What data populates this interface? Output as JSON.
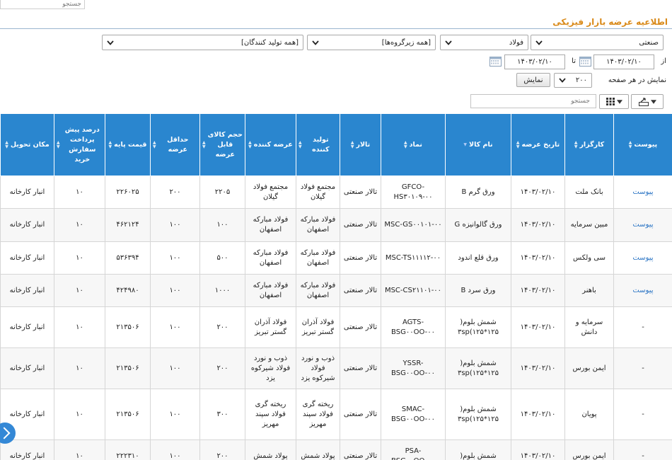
{
  "top_search": {
    "placeholder": "جستجو"
  },
  "page_title": "اطلاعیه عرضه بازار فیزیکی",
  "filters": {
    "hall": "صنعتی",
    "group": "فولاد",
    "subgroup": "[همه زیرگروه‌ها]",
    "producers": "[همه تولید کنندگان]"
  },
  "date_range": {
    "from_label": "از",
    "from_value": "۱۴۰۳/۰۲/۱۰",
    "to_label": "تا",
    "to_value": "۱۴۰۳/۰۲/۱۰"
  },
  "paging": {
    "per_page_label": "نمایش در هر صفحه",
    "per_page_value": "۲۰۰",
    "show_button": "نمایش"
  },
  "grid_search": {
    "placeholder": "جستجو"
  },
  "table": {
    "columns": [
      "پیوست",
      "کارگزار",
      "تاریخ عرضه",
      "نام کالا",
      "نماد",
      "تالار",
      "تولید کننده",
      "عرضه کننده",
      "حجم کالای قابل عرضه",
      "حداقل عرضه",
      "قیمت پایه",
      "درصد پیش پرداخت سفارش خرید",
      "مکان تحویل"
    ],
    "rows": [
      [
        "پیوست",
        "بانک ملت",
        "۱۴۰۳/۰۲/۱۰",
        "ورق گرم B",
        "GFCO-HS۳۰۱۰۹-۰۰",
        "تالار صنعتی",
        "مجتمع فولاد گیلان",
        "مجتمع فولاد گیلان",
        "۲۲۰۵",
        "۲۰۰",
        "۲۲۶۰۲۵",
        "۱۰",
        "انبار کارخانه"
      ],
      [
        "پیوست",
        "مبین سرمایه",
        "۱۴۰۳/۰۲/۱۰",
        "ورق گالوانیزه G",
        "MSC-GS۰۰۱۰۱-۰۰",
        "تالار صنعتی",
        "فولاد مبارکه اصفهان",
        "فولاد مبارکه اصفهان",
        "۱۰۰",
        "۱۰۰",
        "۴۶۲۱۲۴",
        "۱۰",
        "انبار کارخانه"
      ],
      [
        "پیوست",
        "سی ولکس",
        "۱۴۰۳/۰۲/۱۰",
        "ورق قلع اندود",
        "MSC-TS۱۱۱۱۲-۰۰",
        "تالار صنعتی",
        "فولاد مبارکه اصفهان",
        "فولاد مبارکه اصفهان",
        "۵۰۰",
        "۱۰۰",
        "۵۳۶۳۹۴",
        "۱۰",
        "انبار کارخانه"
      ],
      [
        "پیوست",
        "باهنر",
        "۱۴۰۳/۰۲/۱۰",
        "ورق سرد B",
        "MSC-CS۲۱۱۰۱-۰۰",
        "تالار صنعتی",
        "فولاد مبارکه اصفهان",
        "فولاد مبارکه اصفهان",
        "۱۰۰۰",
        "۱۰۰",
        "۴۲۴۹۸۰",
        "۱۰",
        "انبار کارخانه"
      ],
      [
        "-",
        "سرمایه و دانش",
        "۱۴۰۳/۰۲/۱۰",
        "شمش بلوم( ۳sp(۱۲۵*۱۲۵",
        "AGTS-BSG۰۰OO-۰۰",
        "تالار صنعتی",
        "فولاد آذران گستر تبریز",
        "فولاد آذران گستر تبریز",
        "۲۰۰",
        "۱۰۰",
        "۲۱۳۵۰۶",
        "۱۰",
        "انبار کارخانه"
      ],
      [
        "-",
        "ایمن بورس",
        "۱۴۰۳/۰۲/۱۰",
        "شمش بلوم( ۳sp(۱۲۵*۱۲۵",
        "YSSR-BSG۰۰OO-۰۰",
        "تالار صنعتی",
        "ذوب و نورد فولاد شیرکوه یزد",
        "ذوب و نورد فولاد شیرکوه یزد",
        "۲۰۰",
        "۱۰۰",
        "۲۱۳۵۰۶",
        "۱۰",
        "انبار کارخانه"
      ],
      [
        "-",
        "پویان",
        "۱۴۰۳/۰۲/۱۰",
        "شمش بلوم( ۳sp(۱۲۵*۱۲۵",
        "SMAC-BSG۰۰OO-۰۰",
        "تالار صنعتی",
        "ریخته گری فولاد سپند مهریز",
        "ریخته گری فولاد سپند مهریز",
        "۳۰۰",
        "۱۰۰",
        "۲۱۳۵۰۶",
        "۱۰",
        "انبار کارخانه"
      ],
      [
        "-",
        "ایمن بورس",
        "۱۴۰۳/۰۲/۱۰",
        "شمش بلوم(",
        "PSA-BSG۰۰OO-۰۰",
        "تالار صنعتی",
        "پولاد شمش",
        "پولاد شمش",
        "۲۰۰",
        "۱۰۰",
        "۲۲۲۳۱۰",
        "۱۰",
        "انبار کارخانه"
      ]
    ]
  }
}
